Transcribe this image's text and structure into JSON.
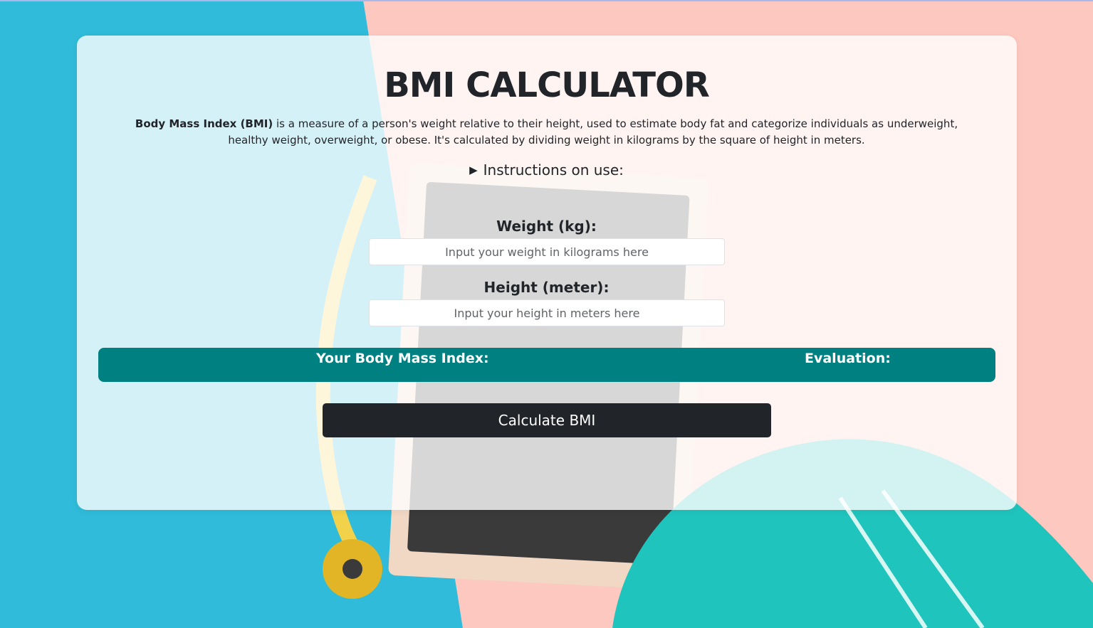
{
  "page": {
    "title": "BMI CALCULATOR",
    "description_bold": "Body Mass Index (BMI)",
    "description_rest": " is a measure of a person's weight relative to their height, used to estimate body fat and categorize individuals as underweight, healthy weight, overweight, or obese. It's calculated by dividing weight in kilograms by the square of height in meters.",
    "instructions_label": "Instructions on use:"
  },
  "form": {
    "weight_label": "Weight (kg):",
    "weight_placeholder": "Input your weight in kilograms here",
    "weight_value": "",
    "height_label": "Height (meter):",
    "height_placeholder": "Input your height in meters here",
    "height_value": ""
  },
  "result": {
    "bmi_label": "Your Body Mass Index:",
    "evaluation_label": "Evaluation:"
  },
  "button": {
    "calculate_label": "Calculate BMI"
  },
  "colors": {
    "result_bar": "#008080",
    "button": "#212529",
    "text": "#212529"
  }
}
